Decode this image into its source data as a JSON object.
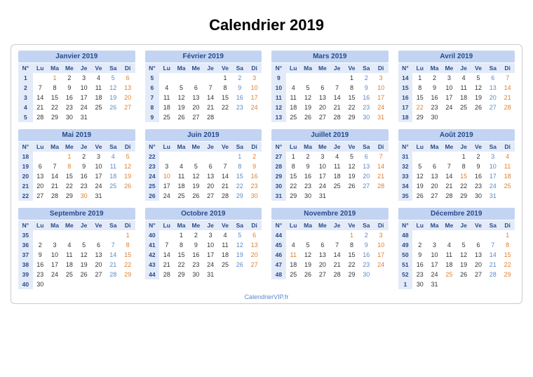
{
  "title": "Calendrier 2019",
  "footer": "CalendrierVIP.fr",
  "day_headers": [
    "N°",
    "Lu",
    "Ma",
    "Me",
    "Je",
    "Ve",
    "Sa",
    "Di"
  ],
  "holidays": {
    "Janvier 2019": [
      1
    ],
    "Avril 2019": [
      22
    ],
    "Mai 2019": [
      1,
      8,
      30
    ],
    "Juin 2019": [
      10
    ],
    "Juillet 2019": [
      14
    ],
    "Août 2019": [
      15
    ],
    "Novembre 2019": [
      1,
      11
    ],
    "Décembre 2019": [
      25
    ]
  },
  "months": [
    {
      "name": "Janvier 2019",
      "weeks": [
        {
          "n": 1,
          "d": [
            null,
            1,
            2,
            3,
            4,
            5,
            6
          ]
        },
        {
          "n": 2,
          "d": [
            7,
            8,
            9,
            10,
            11,
            12,
            13
          ]
        },
        {
          "n": 3,
          "d": [
            14,
            15,
            16,
            17,
            18,
            19,
            20
          ]
        },
        {
          "n": 4,
          "d": [
            21,
            22,
            23,
            24,
            25,
            26,
            27
          ]
        },
        {
          "n": 5,
          "d": [
            28,
            29,
            30,
            31,
            null,
            null,
            null
          ]
        }
      ]
    },
    {
      "name": "Février 2019",
      "weeks": [
        {
          "n": 5,
          "d": [
            null,
            null,
            null,
            null,
            1,
            2,
            3
          ]
        },
        {
          "n": 6,
          "d": [
            4,
            5,
            6,
            7,
            8,
            9,
            10
          ]
        },
        {
          "n": 7,
          "d": [
            11,
            12,
            13,
            14,
            15,
            16,
            17
          ]
        },
        {
          "n": 8,
          "d": [
            18,
            19,
            20,
            21,
            22,
            23,
            24
          ]
        },
        {
          "n": 9,
          "d": [
            25,
            26,
            27,
            28,
            null,
            null,
            null
          ]
        }
      ]
    },
    {
      "name": "Mars 2019",
      "weeks": [
        {
          "n": 9,
          "d": [
            null,
            null,
            null,
            null,
            1,
            2,
            3
          ]
        },
        {
          "n": 10,
          "d": [
            4,
            5,
            6,
            7,
            8,
            9,
            10
          ]
        },
        {
          "n": 11,
          "d": [
            11,
            12,
            13,
            14,
            15,
            16,
            17
          ]
        },
        {
          "n": 12,
          "d": [
            18,
            19,
            20,
            21,
            22,
            23,
            24
          ]
        },
        {
          "n": 13,
          "d": [
            25,
            26,
            27,
            28,
            29,
            30,
            31
          ]
        }
      ]
    },
    {
      "name": "Avril 2019",
      "weeks": [
        {
          "n": 14,
          "d": [
            1,
            2,
            3,
            4,
            5,
            6,
            7
          ]
        },
        {
          "n": 15,
          "d": [
            8,
            9,
            10,
            11,
            12,
            13,
            14
          ]
        },
        {
          "n": 16,
          "d": [
            15,
            16,
            17,
            18,
            19,
            20,
            21
          ]
        },
        {
          "n": 17,
          "d": [
            22,
            23,
            24,
            25,
            26,
            27,
            28
          ]
        },
        {
          "n": 18,
          "d": [
            29,
            30,
            null,
            null,
            null,
            null,
            null
          ]
        }
      ]
    },
    {
      "name": "Mai 2019",
      "weeks": [
        {
          "n": 18,
          "d": [
            null,
            null,
            1,
            2,
            3,
            4,
            5
          ]
        },
        {
          "n": 19,
          "d": [
            6,
            7,
            8,
            9,
            10,
            11,
            12
          ]
        },
        {
          "n": 20,
          "d": [
            13,
            14,
            15,
            16,
            17,
            18,
            19
          ]
        },
        {
          "n": 21,
          "d": [
            20,
            21,
            22,
            23,
            24,
            25,
            26
          ]
        },
        {
          "n": 22,
          "d": [
            27,
            28,
            29,
            30,
            31,
            null,
            null
          ]
        }
      ]
    },
    {
      "name": "Juin 2019",
      "weeks": [
        {
          "n": 22,
          "d": [
            null,
            null,
            null,
            null,
            null,
            1,
            2
          ]
        },
        {
          "n": 23,
          "d": [
            3,
            4,
            5,
            6,
            7,
            8,
            9
          ]
        },
        {
          "n": 24,
          "d": [
            10,
            11,
            12,
            13,
            14,
            15,
            16
          ]
        },
        {
          "n": 25,
          "d": [
            17,
            18,
            19,
            20,
            21,
            22,
            23
          ]
        },
        {
          "n": 26,
          "d": [
            24,
            25,
            26,
            27,
            28,
            29,
            30
          ]
        }
      ]
    },
    {
      "name": "Juillet 2019",
      "weeks": [
        {
          "n": 27,
          "d": [
            1,
            2,
            3,
            4,
            5,
            6,
            7
          ]
        },
        {
          "n": 28,
          "d": [
            8,
            9,
            10,
            11,
            12,
            13,
            14
          ]
        },
        {
          "n": 29,
          "d": [
            15,
            16,
            17,
            18,
            19,
            20,
            21
          ]
        },
        {
          "n": 30,
          "d": [
            22,
            23,
            24,
            25,
            26,
            27,
            28
          ]
        },
        {
          "n": 31,
          "d": [
            29,
            30,
            31,
            null,
            null,
            null,
            null
          ]
        }
      ]
    },
    {
      "name": "Août 2019",
      "weeks": [
        {
          "n": 31,
          "d": [
            null,
            null,
            null,
            1,
            2,
            3,
            4
          ]
        },
        {
          "n": 32,
          "d": [
            5,
            6,
            7,
            8,
            9,
            10,
            11
          ]
        },
        {
          "n": 33,
          "d": [
            12,
            13,
            14,
            15,
            16,
            17,
            18
          ]
        },
        {
          "n": 34,
          "d": [
            19,
            20,
            21,
            22,
            23,
            24,
            25
          ]
        },
        {
          "n": 35,
          "d": [
            26,
            27,
            28,
            29,
            30,
            31,
            null
          ]
        }
      ]
    },
    {
      "name": "Septembre 2019",
      "weeks": [
        {
          "n": 35,
          "d": [
            null,
            null,
            null,
            null,
            null,
            null,
            1
          ]
        },
        {
          "n": 36,
          "d": [
            2,
            3,
            4,
            5,
            6,
            7,
            8
          ]
        },
        {
          "n": 37,
          "d": [
            9,
            10,
            11,
            12,
            13,
            14,
            15
          ]
        },
        {
          "n": 38,
          "d": [
            16,
            17,
            18,
            19,
            20,
            21,
            22
          ]
        },
        {
          "n": 39,
          "d": [
            23,
            24,
            25,
            26,
            27,
            28,
            29
          ]
        },
        {
          "n": 40,
          "d": [
            30,
            null,
            null,
            null,
            null,
            null,
            null
          ]
        }
      ]
    },
    {
      "name": "Octobre 2019",
      "weeks": [
        {
          "n": 40,
          "d": [
            null,
            1,
            2,
            3,
            4,
            5,
            6
          ]
        },
        {
          "n": 41,
          "d": [
            7,
            8,
            9,
            10,
            11,
            12,
            13
          ]
        },
        {
          "n": 42,
          "d": [
            14,
            15,
            16,
            17,
            18,
            19,
            20
          ]
        },
        {
          "n": 43,
          "d": [
            21,
            22,
            23,
            24,
            25,
            26,
            27
          ]
        },
        {
          "n": 44,
          "d": [
            28,
            29,
            30,
            31,
            null,
            null,
            null
          ]
        }
      ]
    },
    {
      "name": "Novembre 2019",
      "weeks": [
        {
          "n": 44,
          "d": [
            null,
            null,
            null,
            null,
            1,
            2,
            3
          ]
        },
        {
          "n": 45,
          "d": [
            4,
            5,
            6,
            7,
            8,
            9,
            10
          ]
        },
        {
          "n": 46,
          "d": [
            11,
            12,
            13,
            14,
            15,
            16,
            17
          ]
        },
        {
          "n": 47,
          "d": [
            18,
            19,
            20,
            21,
            22,
            23,
            24
          ]
        },
        {
          "n": 48,
          "d": [
            25,
            26,
            27,
            28,
            29,
            30,
            null
          ]
        }
      ]
    },
    {
      "name": "Décembre 2019",
      "weeks": [
        {
          "n": 48,
          "d": [
            null,
            null,
            null,
            null,
            null,
            null,
            1
          ]
        },
        {
          "n": 49,
          "d": [
            2,
            3,
            4,
            5,
            6,
            7,
            8
          ]
        },
        {
          "n": 50,
          "d": [
            9,
            10,
            11,
            12,
            13,
            14,
            15
          ]
        },
        {
          "n": 51,
          "d": [
            16,
            17,
            18,
            19,
            20,
            21,
            22
          ]
        },
        {
          "n": 52,
          "d": [
            23,
            24,
            25,
            26,
            27,
            28,
            29
          ]
        },
        {
          "n": 1,
          "d": [
            30,
            31,
            null,
            null,
            null,
            null,
            null
          ]
        }
      ]
    }
  ]
}
